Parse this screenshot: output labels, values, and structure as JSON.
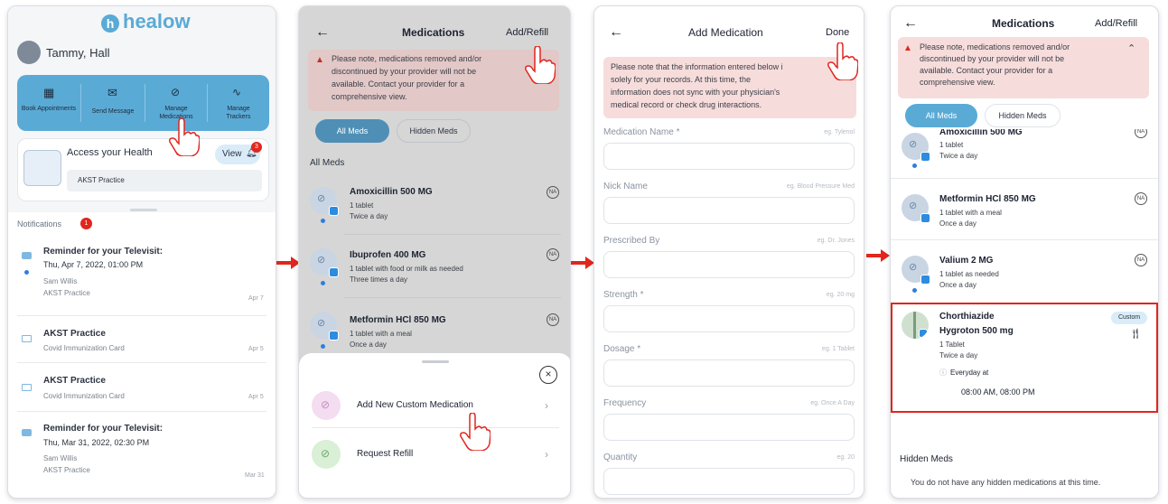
{
  "panel1": {
    "logo": "healow",
    "user_name": "Tammy, Hall",
    "quick_actions": [
      {
        "label": "Book Appointments",
        "icon": "calendar-icon"
      },
      {
        "label": "Send Message",
        "icon": "envelope-icon"
      },
      {
        "label": "Manage Medications",
        "icon": "pill-icon"
      },
      {
        "label": "Manage Trackers",
        "icon": "heartbeat-icon"
      }
    ],
    "health_records": {
      "title": "Access your Health Records",
      "title_visible": "Access your Health",
      "title_tail": "ds",
      "view_label": "View",
      "view_badge": "3",
      "practice": "AKST Practice"
    },
    "notifications_label": "Notifications",
    "notifications_count": "1",
    "notifications": [
      {
        "title": "Reminder for your Televisit:",
        "subtitle": "Thu, Apr 7, 2022, 01:00 PM",
        "line3": "Sam Willis",
        "line4": "AKST Practice",
        "date": "Apr 7"
      },
      {
        "title": "AKST Practice",
        "subtitle": "Covid Immunization Card",
        "date": "Apr 5"
      },
      {
        "title": "AKST Practice",
        "subtitle": "Covid Immunization Card",
        "date": "Apr 5"
      },
      {
        "title": "Reminder for your Televisit:",
        "subtitle": "Thu, Mar 31, 2022, 02:30 PM",
        "line3": "Sam Willis",
        "line4": "AKST Practice",
        "date": "Mar 31"
      }
    ]
  },
  "panel2": {
    "title": "Medications",
    "add_refill": "Add/Refill",
    "notice_lines": [
      "Please note, medications removed and/or",
      "discontinued by your provider will not be",
      "available. Contact your provider for a",
      "comprehensive view."
    ],
    "tabs": [
      "All Meds",
      "Hidden Meds"
    ],
    "section_label": "All Meds",
    "meds": [
      {
        "name": "Amoxicillin 500 MG",
        "line1": "1 tablet",
        "line2": "Twice a day"
      },
      {
        "name": "Ibuprofen 400 MG",
        "line1": "1 tablet with food or milk as needed",
        "line2": "Three times a day"
      },
      {
        "name": "Metformin HCl 850 MG",
        "line1": "1 tablet with a meal",
        "line2": "Once a day"
      }
    ],
    "na_label": "NA",
    "sheet_options": [
      "Add New Custom Medication",
      "Request Refill"
    ]
  },
  "panel3": {
    "title": "Add Medication",
    "done": "Done",
    "notice_lines": [
      "Please note that the information entered below i",
      "solely for your records. At this time, the",
      "information does not sync with your physician's",
      "medical record or check drug interactions."
    ],
    "fields": [
      {
        "label": "Medication Name *",
        "placeholder": "eg. Tylenol"
      },
      {
        "label": "Nick Name",
        "placeholder": "eg. Blood Pressure Med"
      },
      {
        "label": "Prescribed By",
        "placeholder": "eg. Dr. Jones"
      },
      {
        "label": "Strength *",
        "placeholder": "eg. 20 mg"
      },
      {
        "label": "Dosage *",
        "placeholder": "eg. 1 Tablet"
      },
      {
        "label": "Frequency",
        "placeholder": "eg. Once A Day"
      },
      {
        "label": "Quantity",
        "placeholder": "eg. 20"
      }
    ]
  },
  "panel4": {
    "title": "Medications",
    "add_refill": "Add/Refill",
    "notice_lines": [
      "Please note, medications removed and/or",
      "discontinued by your provider will not be",
      "available. Contact your provider for a",
      "comprehensive view."
    ],
    "tabs": [
      "All Meds",
      "Hidden Meds"
    ],
    "meds": [
      {
        "name": "Amoxicillin 500 MG",
        "line1": "1 tablet",
        "line2": "Twice a day"
      },
      {
        "name": "Metformin HCl 850 MG",
        "line1": "1 tablet with a meal",
        "line2": "Once a day"
      },
      {
        "name": "Valium 2 MG",
        "line1": "1 tablet as needed",
        "line2": "Once a day"
      }
    ],
    "na_label": "NA",
    "custom_med": {
      "name": "Chorthiazide",
      "brand": "Hygroton 500 mg",
      "line1": "1 Tablet",
      "line2": "Twice a day",
      "badge": "Custom",
      "schedule_label": "Everyday at",
      "times": "08:00 AM, 08:00 PM"
    },
    "hidden_title": "Hidden Meds",
    "hidden_empty": "You do not have any hidden medications at this time."
  },
  "colors": {
    "accent_blue": "#5aaad6",
    "alert_red": "#e0261e",
    "notice_bg": "#f7dcdc"
  }
}
